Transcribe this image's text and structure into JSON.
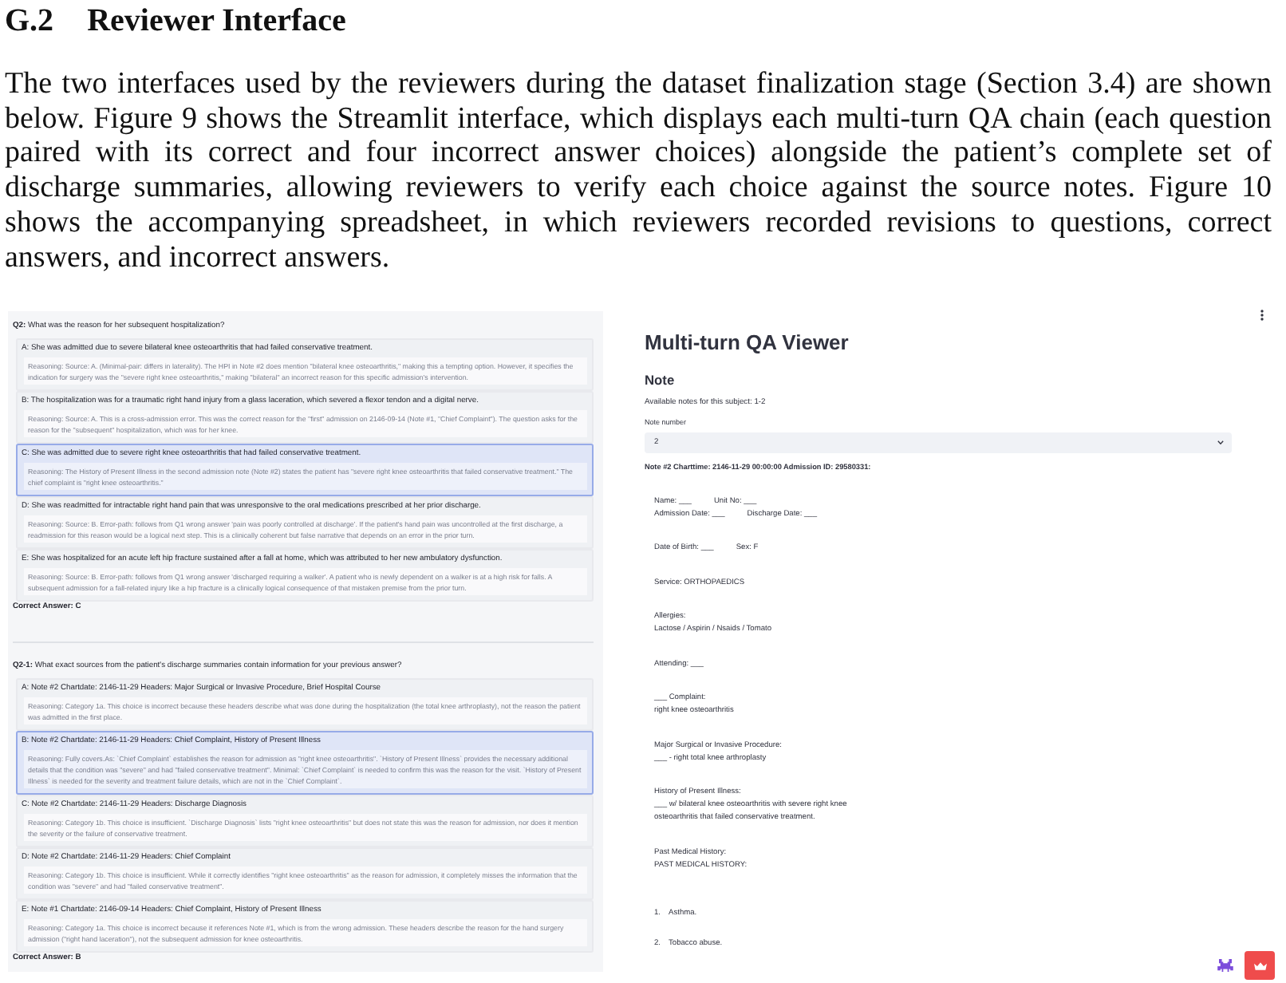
{
  "section": {
    "number": "G.2",
    "title": "Reviewer Interface"
  },
  "intro": "The two interfaces used by the reviewers during the dataset finalization stage (Section 3.4) are shown below. Figure 9 shows the Streamlit interface, which displays each multi-turn QA chain (each question paired with its correct and four incorrect answer choices) alongside the patient’s complete set of discharge summaries, allowing reviewers to verify each choice against the source notes. Figure 10 shows the accompanying spreadsheet, in which reviewers recorded revisions to questions, correct answers, and incorrect answers.",
  "qa_panel": {
    "questions": [
      {
        "question": "**Q2:** What was the reason for her subsequent hospitalization?",
        "choices": [
          {
            "text": "A: She was admitted due to severe bilateral knee osteoarthritis that had failed conservative treatment.",
            "reasoning": "Reasoning: Source: A. (Minimal-pair: differs in laterality). The HPI in Note #2 does mention \"bilateral knee osteoarthritis,\" making this a tempting option. However, it specifies the indication for surgery was the \"severe right knee osteoarthritis,\" making \"bilateral\" an incorrect reason for this specific admission's intervention.",
            "correct": false
          },
          {
            "text": "B: The hospitalization was for a traumatic right hand injury from a glass laceration, which severed a flexor tendon and a digital nerve.",
            "reasoning": "Reasoning: Source: A. This is a cross-admission error. This was the correct reason for the \"first\" admission on 2146-09-14 (Note #1, \"Chief Complaint\"). The question asks for the reason for the \"subsequent\" hospitalization, which was for her knee.",
            "correct": false
          },
          {
            "text": "C: She was admitted due to severe right knee osteoarthritis that had failed conservative treatment.",
            "reasoning": "Reasoning: The History of Present Illness in the second admission note (Note #2) states the patient has \"severe right knee osteoarthritis that failed conservative treatment.\" The chief complaint is \"right knee osteoarthritis.\"",
            "correct": true
          },
          {
            "text": "D: She was readmitted for intractable right hand pain that was unresponsive to the oral medications prescribed at her prior discharge.",
            "reasoning": "Reasoning: Source: B. Error-path: follows from Q1 wrong answer 'pain was poorly controlled at discharge'. If the patient's hand pain was uncontrolled at the first discharge, a readmission for this reason would be a logical next step. This is a clinically coherent but false narrative that depends on an error in the prior turn.",
            "correct": false
          },
          {
            "text": "E: She was hospitalized for an acute left hip fracture sustained after a fall at home, which was attributed to her new ambulatory dysfunction.",
            "reasoning": "Reasoning: Source: B. Error-path: follows from Q1 wrong answer 'discharged requiring a walker'. A patient who is newly dependent on a walker is at a high risk for falls. A subsequent admission for a fall-related injury like a hip fracture is a clinically logical consequence of that mistaken premise from the prior turn.",
            "correct": false
          }
        ],
        "correct_answer": "Correct Answer: C"
      },
      {
        "question": "**Q2-1:** What exact sources from the patient's discharge summaries contain information for your previous answer?",
        "choices": [
          {
            "text": "A: Note #2 Chartdate: 2146-11-29 Headers: Major Surgical or Invasive Procedure, Brief Hospital Course",
            "reasoning": "Reasoning: Category 1a. This choice is incorrect because these headers describe what was done during the hospitalization (the total knee arthroplasty), not the reason the patient was admitted in the first place.",
            "correct": false
          },
          {
            "text": "B: Note #2 Chartdate: 2146-11-29 Headers: Chief Complaint, History of Present Illness",
            "reasoning": "Reasoning: Fully covers.As: `Chief Complaint` establishes the reason for admission as \"right knee osteoarthritis\". `History of Present Illness` provides the necessary additional details that the condition was \"severe\" and had \"failed conservative treatment\". Minimal: `Chief Complaint` is needed to confirm this was the reason for the visit. `History of Present Illness` is needed for the severity and treatment failure details, which are not in the `Chief Complaint`.",
            "correct": true
          },
          {
            "text": "C: Note #2 Chartdate: 2146-11-29 Headers: Discharge Diagnosis",
            "reasoning": "Reasoning: Category 1b. This choice is insufficient. `Discharge Diagnosis` lists \"right knee osteoarthritis\" but does not state this was the reason for admission, nor does it mention the severity or the failure of conservative treatment.",
            "correct": false
          },
          {
            "text": "D: Note #2 Chartdate: 2146-11-29 Headers: Chief Complaint",
            "reasoning": "Reasoning: Category 1b. This choice is insufficient. While it correctly identifies \"right knee osteoarthritis\" as the reason for admission, it completely misses the information that the condition was \"severe\" and had \"failed conservative treatment\".",
            "correct": false
          },
          {
            "text": "E: Note #1 Chartdate: 2146-09-14 Headers: Chief Complaint, History of Present Illness",
            "reasoning": "Reasoning: Category 1a. This choice is incorrect because it references Note #1, which is from the wrong admission. These headers describe the reason for the hand surgery admission (\"right hand laceration\"), not the subsequent admission for knee osteoarthritis.",
            "correct": false
          }
        ],
        "correct_answer": "Correct Answer: B"
      }
    ]
  },
  "viewer": {
    "title": "Multi-turn QA Viewer",
    "subtitle": "Note",
    "available_notes": "Available notes for this subject: 1-2",
    "note_select": {
      "label": "Note number",
      "value": "2"
    },
    "note_header": "Note #2 Charttime: 2146-11-29 00:00:00 Admission ID: 29580331:",
    "note_blocks": [
      {
        "kind": "fields",
        "lines": [
          [
            "Name: ___",
            "Unit No: ___"
          ],
          [
            "Admission Date: ___",
            "Discharge Date: ___"
          ]
        ]
      },
      {
        "kind": "fields",
        "lines": [
          [
            "Date of Birth: ___",
            "Sex: F"
          ]
        ]
      },
      {
        "kind": "text",
        "lines": [
          "Service: ORTHOPAEDICS"
        ]
      },
      {
        "kind": "text",
        "lines": [
          "Allergies:",
          "Lactose / Aspirin / Nsaids / Tomato"
        ]
      },
      {
        "kind": "text",
        "lines": [
          "Attending: ___"
        ]
      },
      {
        "kind": "text",
        "lines": [
          "___ Complaint:",
          "right knee osteoarthritis"
        ]
      },
      {
        "kind": "text",
        "lines": [
          "Major Surgical or Invasive Procedure:",
          "___ - right total knee arthroplasty"
        ]
      },
      {
        "kind": "text",
        "lines": [
          "History of Present Illness:",
          "___ w/ bilateral knee osteoarthritis with severe right knee",
          "osteoarthritis that failed conservative treatment."
        ]
      },
      {
        "kind": "text",
        "lines": [
          "Past Medical History:",
          "PAST MEDICAL HISTORY:"
        ]
      },
      {
        "kind": "list_item",
        "number": "1.",
        "text": "Asthma."
      },
      {
        "kind": "list_item",
        "number": "2.",
        "text": "Tobacco abuse."
      }
    ]
  }
}
